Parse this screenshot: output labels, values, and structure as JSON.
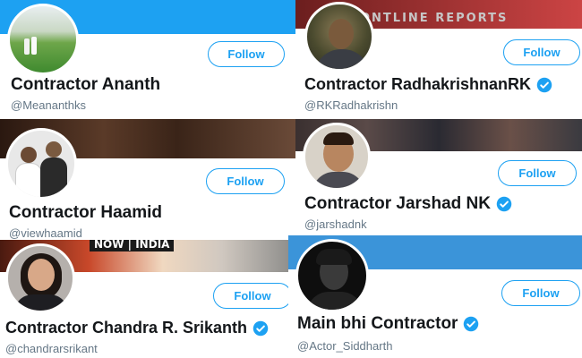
{
  "colors": {
    "accent": "#1da1f2",
    "verified": "#1da1f2",
    "name_text": "#14171a",
    "handle_text": "#657786"
  },
  "icons": {
    "verified": "verified-badge-icon"
  },
  "profiles": [
    {
      "display_name": "Contractor Ananth",
      "handle": "@Meananthks",
      "follow_label": "Follow",
      "verified": false,
      "banner_color": "#1da1f2"
    },
    {
      "display_name": "Contractor RadhakrishnanRK",
      "handle": "@RKRadhakrishn",
      "follow_label": "Follow",
      "verified": true,
      "banner_text": "ONTLINE REPORTS"
    },
    {
      "display_name": "Contractor Haamid",
      "handle": "@viewhaamid",
      "follow_label": "Follow",
      "verified": false
    },
    {
      "display_name": "Contractor Jarshad NK",
      "handle": "@jarshadnk",
      "follow_label": "Follow",
      "verified": true
    },
    {
      "display_name": "Contractor Chandra R. Srikanth",
      "handle": "@chandrarsrikant",
      "follow_label": "Follow",
      "verified": true,
      "banner_text": "NOW | INDIA"
    },
    {
      "display_name": "Main bhi Contractor",
      "handle": "@Actor_Siddharth",
      "follow_label": "Follow",
      "verified": true,
      "banner_color": "#3b94d9"
    }
  ]
}
